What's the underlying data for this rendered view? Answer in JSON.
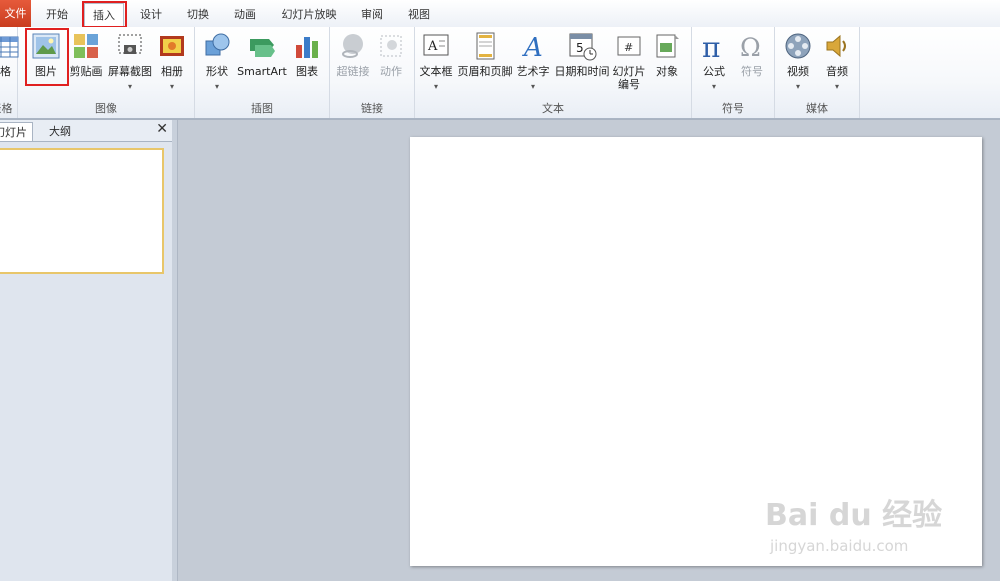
{
  "tabs": [
    {
      "label": "文件",
      "key": "file"
    },
    {
      "label": "开始",
      "key": "home"
    },
    {
      "label": "插入",
      "key": "insert"
    },
    {
      "label": "设计",
      "key": "design"
    },
    {
      "label": "切换",
      "key": "transitions"
    },
    {
      "label": "动画",
      "key": "animations"
    },
    {
      "label": "幻灯片放映",
      "key": "slideshow"
    },
    {
      "label": "审阅",
      "key": "review"
    },
    {
      "label": "视图",
      "key": "view"
    }
  ],
  "groups": {
    "tables": "表格",
    "images": "图像",
    "illustrations": "插图",
    "links": "链接",
    "text": "文本",
    "symbols": "符号",
    "media": "媒体"
  },
  "buttons": {
    "table": "表格",
    "picture": "图片",
    "clipart": "剪贴画",
    "screenshot": "屏幕截图",
    "album": "相册",
    "shapes": "形状",
    "smartart": "SmartArt",
    "chart": "图表",
    "hyperlink": "超链接",
    "action": "动作",
    "textbox": "文本框",
    "header_footer": "页眉和页脚",
    "wordart": "艺术字",
    "datetime": "日期和时间",
    "slide_number_1": "幻灯片",
    "slide_number_2": "编号",
    "object": "对象",
    "equation": "公式",
    "symbol": "符号",
    "video": "视频",
    "audio": "音频"
  },
  "pane": {
    "tab_slides": "幻灯片",
    "tab_outline": "大纲",
    "close": "✕"
  },
  "watermark": {
    "brand": "Bai du 经验",
    "url": "jingyan.baidu.com"
  },
  "colors": {
    "file_tab": "#d2472a",
    "highlight": "#e02020",
    "thumb_border": "#e8c66a"
  }
}
